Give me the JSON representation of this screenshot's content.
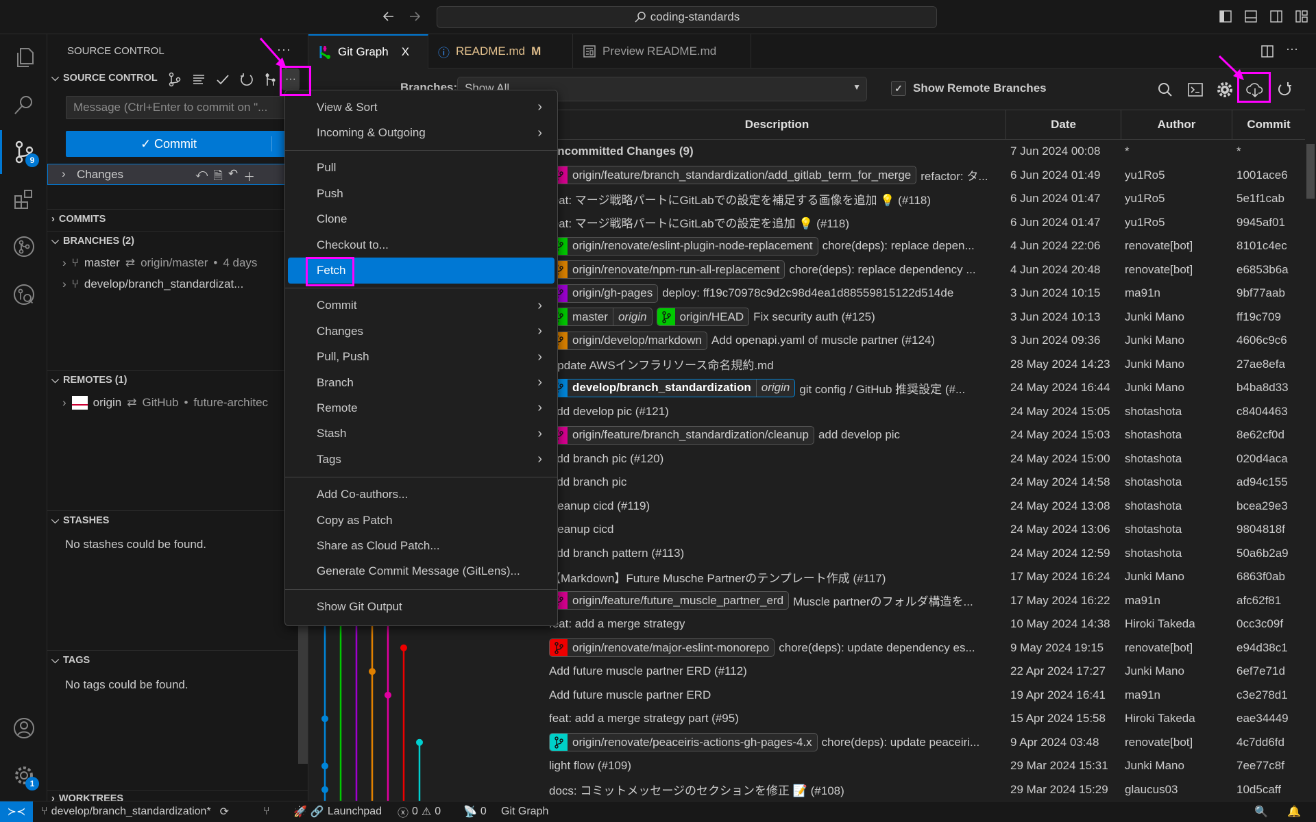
{
  "titlebar": {
    "search_text": "coding-standards"
  },
  "activity_bar": {
    "items": [
      {
        "icon": "files-icon"
      },
      {
        "icon": "search-icon"
      },
      {
        "icon": "source-control-icon",
        "badge": "9"
      },
      {
        "icon": "extensions-icon"
      },
      {
        "icon": "gitlens-icon"
      },
      {
        "icon": "gitlens-inspect-icon"
      },
      {
        "icon": "account-icon"
      },
      {
        "icon": "gear-icon",
        "badge": "1"
      }
    ]
  },
  "sidebar": {
    "title": "SOURCE CONTROL",
    "scm_header": "SOURCE CONTROL",
    "message_placeholder": "Message (Ctrl+Enter to commit on \"...",
    "commit_label": "Commit",
    "changes_label": "Changes",
    "commits_header": "COMMITS",
    "branches_header": "BRANCHES (2)",
    "branches": [
      {
        "name": "master",
        "upstream": "origin/master",
        "age": "4 days"
      },
      {
        "name": "develop/branch_standardizat..."
      }
    ],
    "remotes_header": "REMOTES (1)",
    "remotes": [
      {
        "name": "origin",
        "provider": "GitHub",
        "detail": "future-architec"
      }
    ],
    "stashes_header": "STASHES",
    "stashes_empty": "No stashes could be found.",
    "tags_header": "TAGS",
    "tags_empty": "No tags could be found.",
    "worktrees_header": "WORKTREES"
  },
  "tabs": [
    {
      "label": "Git Graph",
      "active": true,
      "close": "X"
    },
    {
      "label": "README.md",
      "modified": "M"
    },
    {
      "label": "Preview README.md"
    }
  ],
  "git_graph": {
    "branches_label": "Branches:",
    "branches_value": "Show All",
    "show_remote_label": "Show Remote Branches",
    "show_remote_checked": true,
    "columns": [
      "Description",
      "Date",
      "Author",
      "Commit"
    ],
    "lane_colors": [
      "#0085d9",
      "#00c800",
      "#a000d0",
      "#e08000",
      "#e000a0",
      "#ee0000",
      "#00d0d0"
    ],
    "rows": [
      {
        "message": "Uncommitted Changes (9)",
        "bold": true,
        "date": "7 Jun 2024 00:08",
        "author": "*",
        "commit": "*"
      },
      {
        "refs": [
          {
            "name": "origin/feature/branch_standardization/add_gitlab_term_for_merge",
            "color": "#d6008f"
          }
        ],
        "message": "refactor: タ...",
        "date": "6 Jun 2024 01:49",
        "author": "yu1Ro5",
        "commit": "1001ace6"
      },
      {
        "message": "feat: マージ戦略パートにGitLabでの設定を補足する画像を追加 💡 (#118)",
        "date": "6 Jun 2024 01:47",
        "author": "yu1Ro5",
        "commit": "5e1f1cab"
      },
      {
        "message": "feat: マージ戦略パートにGitLabでの設定を追加 💡 (#118)",
        "date": "6 Jun 2024 01:47",
        "author": "yu1Ro5",
        "commit": "9945af01"
      },
      {
        "refs": [
          {
            "name": "origin/renovate/eslint-plugin-node-replacement",
            "color": "#00c800"
          }
        ],
        "message": "chore(deps): replace depen...",
        "date": "4 Jun 2024 22:06",
        "author": "renovate[bot]",
        "commit": "8101c4ec"
      },
      {
        "refs": [
          {
            "name": "origin/renovate/npm-run-all-replacement",
            "color": "#d88000"
          }
        ],
        "message": "chore(deps): replace dependency ...",
        "date": "4 Jun 2024 20:48",
        "author": "renovate[bot]",
        "commit": "e6853b6a"
      },
      {
        "refs": [
          {
            "name": "origin/gh-pages",
            "color": "#9c00d0"
          }
        ],
        "message": "deploy: ff19c70978c9d2c98d4ea1d88559815122d514de",
        "date": "3 Jun 2024 10:15",
        "author": "ma91n",
        "commit": "9bf77aab"
      },
      {
        "refs": [
          {
            "name": "master",
            "remote": "origin",
            "color": "#00c800"
          },
          {
            "name": "origin/HEAD",
            "color": "#00c800"
          }
        ],
        "message": "Fix security auth (#125)",
        "date": "3 Jun 2024 10:13",
        "author": "Junki Mano",
        "commit": "ff19c709"
      },
      {
        "refs": [
          {
            "name": "origin/develop/markdown",
            "color": "#d88000"
          }
        ],
        "message": "Add openapi.yaml of muscle partner (#124)",
        "date": "3 Jun 2024 09:36",
        "author": "Junki Mano",
        "commit": "4606c9c6"
      },
      {
        "message": "Update AWSインフラリソース命名規約.md",
        "date": "28 May 2024 14:23",
        "author": "Junki Mano",
        "commit": "27ae8efa"
      },
      {
        "refs": [
          {
            "name": "develop/branch_standardization",
            "remote": "origin",
            "color": "#0085d9",
            "head": true
          }
        ],
        "message": "git config / GitHub 推奨設定 (#...",
        "date": "24 May 2024 16:44",
        "author": "Junki Mano",
        "commit": "b4ba8d33"
      },
      {
        "message": "Add develop pic (#121)",
        "date": "24 May 2024 15:05",
        "author": "shotashota",
        "commit": "c8404463"
      },
      {
        "refs": [
          {
            "name": "origin/feature/branch_standardization/cleanup",
            "color": "#d6008f"
          }
        ],
        "message": "add develop pic",
        "date": "24 May 2024 15:03",
        "author": "shotashota",
        "commit": "8e62cf0d"
      },
      {
        "message": "Add branch pic (#120)",
        "date": "24 May 2024 15:00",
        "author": "shotashota",
        "commit": "020d4aca"
      },
      {
        "message": "Add branch pic",
        "date": "24 May 2024 14:58",
        "author": "shotashota",
        "commit": "ad94c155"
      },
      {
        "message": "cleanup cicd (#119)",
        "date": "24 May 2024 13:08",
        "author": "shotashota",
        "commit": "bcea29e3"
      },
      {
        "message": "cleanup cicd",
        "date": "24 May 2024 13:06",
        "author": "shotashota",
        "commit": "9804818f"
      },
      {
        "message": "Add branch pattern (#113)",
        "date": "24 May 2024 12:59",
        "author": "shotashota",
        "commit": "50a6b2a9"
      },
      {
        "message": "【Markdown】Future Musche Partnerのテンプレート作成 (#117)",
        "date": "17 May 2024 16:24",
        "author": "Junki Mano",
        "commit": "6863f0ab"
      },
      {
        "refs": [
          {
            "name": "origin/feature/future_muscle_partner_erd",
            "color": "#d6008f"
          }
        ],
        "message": "Muscle partnerのフォルダ構造を...",
        "date": "17 May 2024 16:22",
        "author": "ma91n",
        "commit": "afc62f81"
      },
      {
        "message": "feat: add a merge strategy",
        "date": "10 May 2024 14:38",
        "author": "Hiroki Takeda",
        "commit": "0cc3c09f"
      },
      {
        "refs": [
          {
            "name": "origin/renovate/major-eslint-monorepo",
            "color": "#ee0000"
          }
        ],
        "message": "chore(deps): update dependency es...",
        "date": "9 May 2024 19:15",
        "author": "renovate[bot]",
        "commit": "e94d38c1"
      },
      {
        "message": "Add future muscle partner ERD (#112)",
        "date": "22 Apr 2024 17:27",
        "author": "Junki Mano",
        "commit": "6ef7e71d"
      },
      {
        "message": "Add future muscle partner ERD",
        "date": "19 Apr 2024 16:41",
        "author": "ma91n",
        "commit": "c3e278d1"
      },
      {
        "message": "feat: add a merge strategy part (#95)",
        "date": "15 Apr 2024 15:58",
        "author": "Hiroki Takeda",
        "commit": "eae34449"
      },
      {
        "refs": [
          {
            "name": "origin/renovate/peaceiris-actions-gh-pages-4.x",
            "color": "#00d0c8"
          }
        ],
        "message": "chore(deps): update peaceiri...",
        "date": "9 Apr 2024 03:48",
        "author": "renovate[bot]",
        "commit": "4c7dd6fd"
      },
      {
        "message": "light flow (#109)",
        "date": "29 Mar 2024 15:31",
        "author": "Junki Mano",
        "commit": "7ee77c8f"
      },
      {
        "message": "docs: コミットメッセージのセクションを修正 📝 (#108)",
        "date": "29 Mar 2024 15:29",
        "author": "glaucus03",
        "commit": "10d5caff"
      }
    ]
  },
  "context_menu": {
    "groups": [
      [
        {
          "label": "View & Sort",
          "submenu": true
        },
        {
          "label": "Incoming & Outgoing",
          "submenu": true
        }
      ],
      [
        {
          "label": "Pull"
        },
        {
          "label": "Push"
        },
        {
          "label": "Clone"
        },
        {
          "label": "Checkout to..."
        },
        {
          "label": "Fetch",
          "highlighted": true
        }
      ],
      [
        {
          "label": "Commit",
          "submenu": true
        },
        {
          "label": "Changes",
          "submenu": true
        },
        {
          "label": "Pull, Push",
          "submenu": true
        },
        {
          "label": "Branch",
          "submenu": true
        },
        {
          "label": "Remote",
          "submenu": true
        },
        {
          "label": "Stash",
          "submenu": true
        },
        {
          "label": "Tags",
          "submenu": true
        }
      ],
      [
        {
          "label": "Add Co-authors..."
        },
        {
          "label": "Copy as Patch"
        },
        {
          "label": "Share as Cloud Patch..."
        },
        {
          "label": "Generate Commit Message (GitLens)..."
        }
      ],
      [
        {
          "label": "Show Git Output"
        }
      ]
    ]
  },
  "statusbar": {
    "branch": "develop/branch_standardization*",
    "launchpad": "Launchpad",
    "errors": "0",
    "warnings": "0",
    "ports": "0",
    "git_graph": "Git Graph"
  },
  "annotation_color": "#ff00ff",
  "accent_color": "#0078d4"
}
